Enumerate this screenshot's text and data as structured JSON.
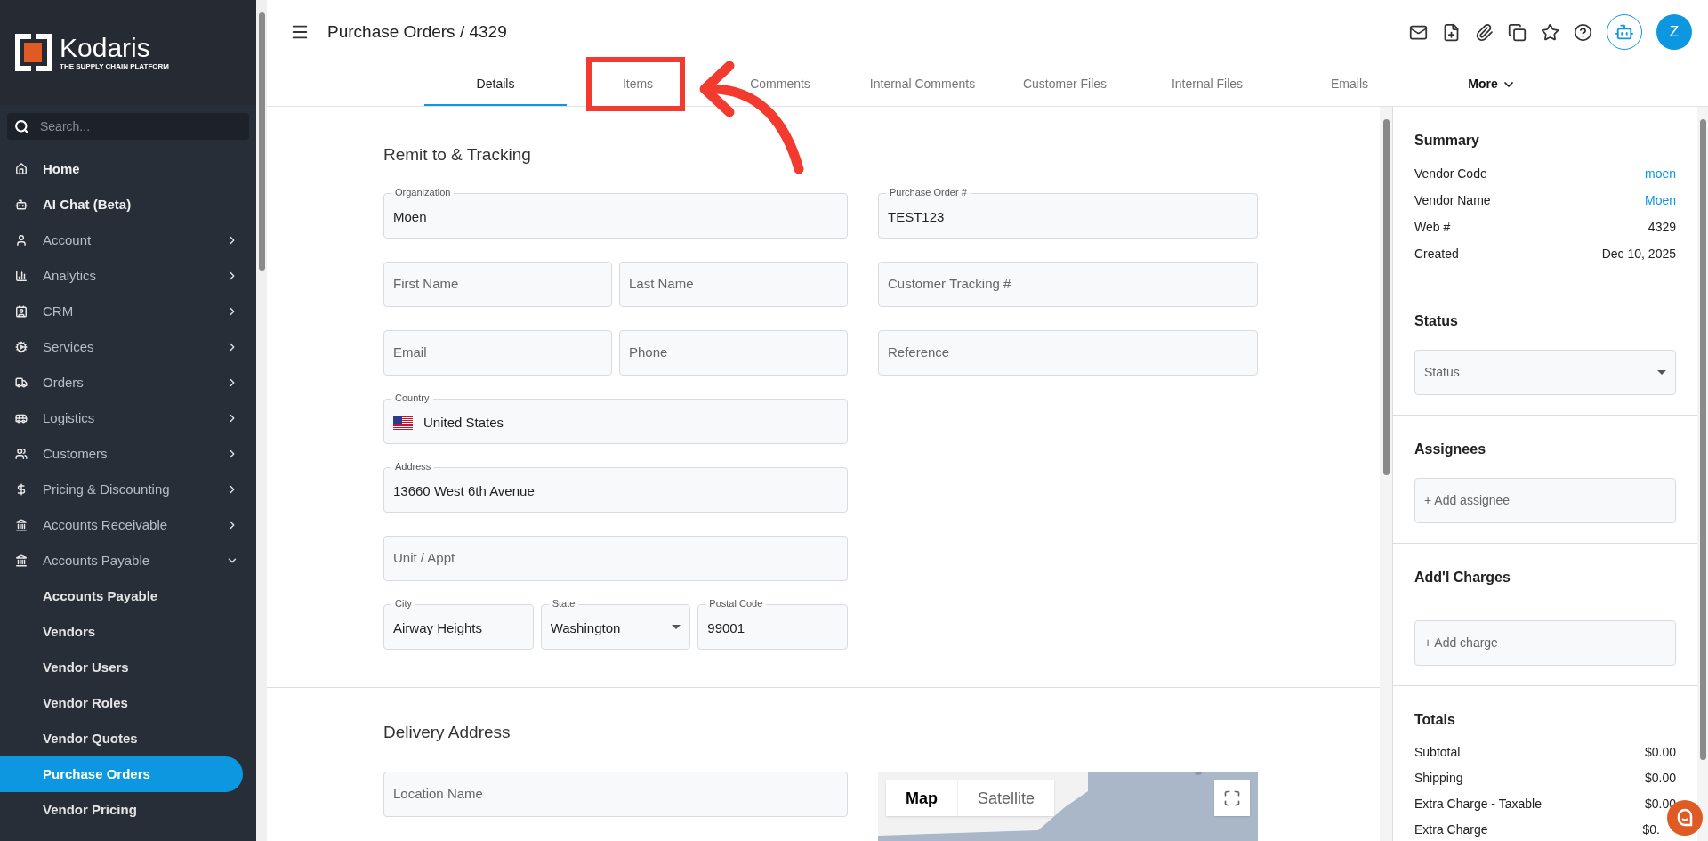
{
  "sidebar": {
    "logo": {
      "name": "Kodaris",
      "tagline": "THE SUPPLY CHAIN PLATFORM"
    },
    "search": {
      "placeholder": "Search..."
    },
    "items": [
      {
        "label": "Home",
        "kind": "link"
      },
      {
        "label": "AI Chat (Beta)",
        "kind": "link"
      },
      {
        "label": "Account",
        "kind": "group",
        "expanded": false
      },
      {
        "label": "Analytics",
        "kind": "group",
        "expanded": false
      },
      {
        "label": "CRM",
        "kind": "group",
        "expanded": false
      },
      {
        "label": "Services",
        "kind": "group",
        "expanded": false
      },
      {
        "label": "Orders",
        "kind": "group",
        "expanded": false
      },
      {
        "label": "Logistics",
        "kind": "group",
        "expanded": false
      },
      {
        "label": "Customers",
        "kind": "group",
        "expanded": false
      },
      {
        "label": "Pricing & Discounting",
        "kind": "group",
        "expanded": false
      },
      {
        "label": "Accounts Receivable",
        "kind": "group",
        "expanded": false
      },
      {
        "label": "Accounts Payable",
        "kind": "group",
        "expanded": true,
        "children": [
          {
            "label": "Accounts Payable",
            "selected": false
          },
          {
            "label": "Vendors",
            "selected": false
          },
          {
            "label": "Vendor Users",
            "selected": false
          },
          {
            "label": "Vendor Roles",
            "selected": false
          },
          {
            "label": "Vendor Quotes",
            "selected": false
          },
          {
            "label": "Purchase Orders",
            "selected": true
          },
          {
            "label": "Vendor Pricing",
            "selected": false
          }
        ]
      }
    ]
  },
  "header": {
    "title": "Purchase Orders / 4329",
    "avatar": "Z"
  },
  "tabs": [
    {
      "label": "Details",
      "selected": true
    },
    {
      "label": "Items",
      "selected": false
    },
    {
      "label": "Comments",
      "selected": false
    },
    {
      "label": "Internal Comments",
      "selected": false
    },
    {
      "label": "Customer Files",
      "selected": false
    },
    {
      "label": "Internal Files",
      "selected": false
    },
    {
      "label": "Emails",
      "selected": false
    },
    {
      "label": "More",
      "selected": false
    }
  ],
  "remit": {
    "title": "Remit to & Tracking",
    "left": [
      [
        {
          "label": "Organization",
          "value": "Moen"
        }
      ],
      [
        {
          "placeholder": "First Name"
        },
        {
          "placeholder": "Last Name"
        }
      ],
      [
        {
          "placeholder": "Email"
        },
        {
          "placeholder": "Phone"
        }
      ],
      [
        {
          "label": "Country",
          "value": "United States",
          "kind": "country"
        }
      ],
      [
        {
          "label": "Address",
          "value": "13660 West 6th Avenue"
        }
      ],
      [
        {
          "placeholder": "Unit / Appt"
        }
      ],
      [
        {
          "label": "City",
          "value": "Airway Heights"
        },
        {
          "label": "State",
          "value": "Washington",
          "kind": "select"
        },
        {
          "label": "Postal Code",
          "value": "99001"
        }
      ]
    ],
    "right": [
      {
        "label": "Purchase Order #",
        "value": "TEST123"
      },
      {
        "placeholder": "Customer Tracking #"
      },
      {
        "placeholder": "Reference"
      }
    ]
  },
  "delivery": {
    "title": "Delivery Address",
    "location": {
      "placeholder": "Location Name"
    },
    "map": {
      "buttons": [
        {
          "label": "Map",
          "selected": true
        },
        {
          "label": "Satellite",
          "selected": false
        }
      ]
    }
  },
  "summary": {
    "title": "Summary",
    "rows": [
      {
        "label": "Vendor Code",
        "value": "moen",
        "kind": "link"
      },
      {
        "label": "Vendor Name",
        "value": "Moen",
        "kind": "link"
      },
      {
        "label": "Web #",
        "value": "4329",
        "kind": "text"
      },
      {
        "label": "Created",
        "value": "Dec 10, 2025",
        "kind": "text"
      }
    ]
  },
  "status": {
    "title": "Status",
    "placeholder": "Status"
  },
  "assignees": {
    "title": "Assignees",
    "placeholder": "+ Add assignee"
  },
  "charges": {
    "title": "Add'l Charges",
    "placeholder": "+ Add charge"
  },
  "totals": {
    "title": "Totals",
    "rows": [
      {
        "label": "Subtotal",
        "value": "$0.00"
      },
      {
        "label": "Shipping",
        "value": "$0.00"
      },
      {
        "label": "Extra Charge - Taxable",
        "value": "$0.00"
      },
      {
        "label": "Extra Charge",
        "value": "$0."
      }
    ]
  }
}
